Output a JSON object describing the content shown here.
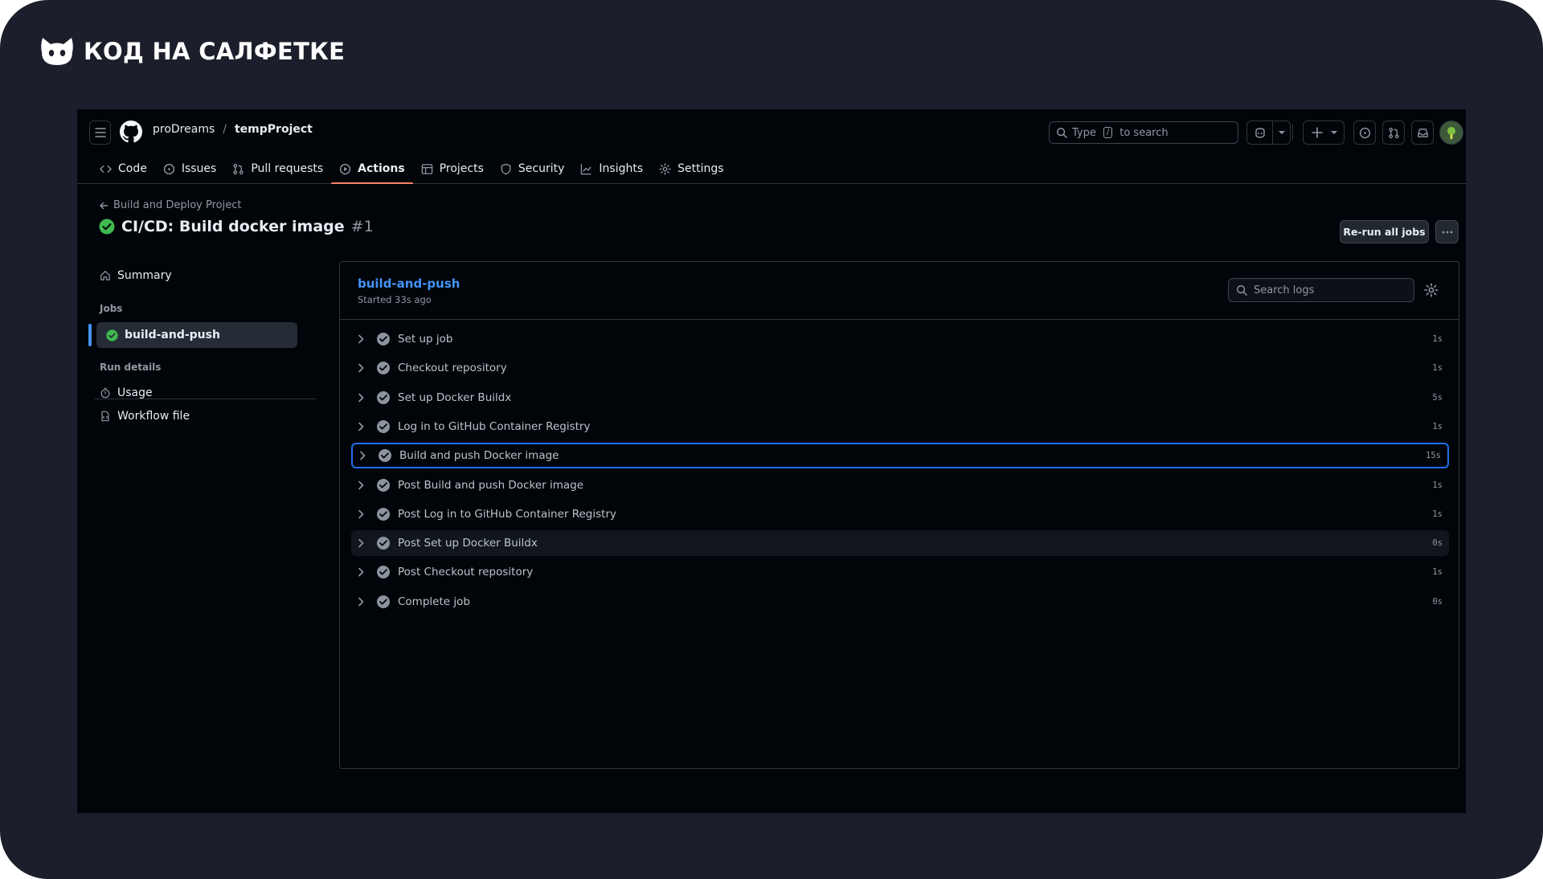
{
  "brand": {
    "text": "КОД НА САЛФЕТКЕ"
  },
  "header": {
    "owner": "proDreams",
    "separator": "/",
    "repo": "tempProject",
    "search": {
      "before": "Type",
      "key": "/",
      "after": "to search"
    }
  },
  "tabs": [
    {
      "label": "Code",
      "icon": "code-icon"
    },
    {
      "label": "Issues",
      "icon": "issue-opened-icon"
    },
    {
      "label": "Pull requests",
      "icon": "git-pull-request-icon"
    },
    {
      "label": "Actions",
      "icon": "play-icon",
      "active": true
    },
    {
      "label": "Projects",
      "icon": "table-icon"
    },
    {
      "label": "Security",
      "icon": "shield-icon"
    },
    {
      "label": "Insights",
      "icon": "graph-icon"
    },
    {
      "label": "Settings",
      "icon": "gear-icon"
    }
  ],
  "run": {
    "back_label": "Build and Deploy Project",
    "title": "CI/CD: Build docker image",
    "number": "#1",
    "rerun_label": "Re-run all jobs"
  },
  "sidebar": {
    "summary": "Summary",
    "jobs_heading": "Jobs",
    "job": "build-and-push",
    "run_details_heading": "Run details",
    "usage": "Usage",
    "workflow_file": "Workflow file"
  },
  "job": {
    "name": "build-and-push",
    "started": "Started 33s ago",
    "search_placeholder": "Search logs",
    "steps": [
      {
        "name": "Set up job",
        "duration": "1s"
      },
      {
        "name": "Checkout repository",
        "duration": "1s"
      },
      {
        "name": "Set up Docker Buildx",
        "duration": "5s"
      },
      {
        "name": "Log in to GitHub Container Registry",
        "duration": "1s"
      },
      {
        "name": "Build and push Docker image",
        "duration": "15s",
        "highlighted": true
      },
      {
        "name": "Post Build and push Docker image",
        "duration": "1s"
      },
      {
        "name": "Post Log in to GitHub Container Registry",
        "duration": "1s"
      },
      {
        "name": "Post Set up Docker Buildx",
        "duration": "0s",
        "hover": true
      },
      {
        "name": "Post Checkout repository",
        "duration": "1s"
      },
      {
        "name": "Complete job",
        "duration": "0s"
      }
    ]
  },
  "colors": {
    "accent": "#4493f8",
    "success": "#3fb950",
    "tab_underline": "#f78166",
    "background": "#010409"
  }
}
